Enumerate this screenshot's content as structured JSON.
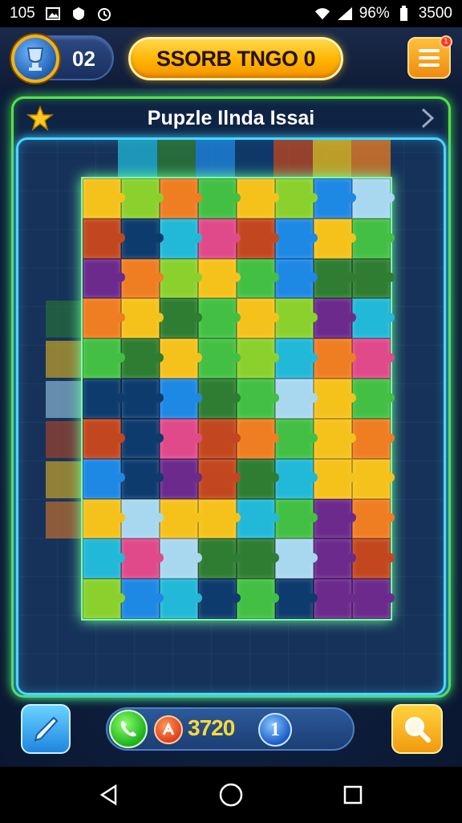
{
  "status": {
    "time": "105",
    "battery": "96%",
    "clock": "3500"
  },
  "header": {
    "level": "02",
    "title": "SSORB TNGO 0",
    "notification_count": "1"
  },
  "panel": {
    "title": "Pupzle Ilnda Issai"
  },
  "footer": {
    "score": "3720",
    "info_label": "1"
  },
  "colors": {
    "accent_green": "#58e04a",
    "accent_cyan": "#48d8ff",
    "brand_orange": "#ffb400",
    "piece_palette": [
      "#1e88e5",
      "#ef7d22",
      "#43c043",
      "#22b8d8",
      "#0e3b6e",
      "#f5c21b",
      "#8bd12e",
      "#c2471f",
      "#6b2a8c",
      "#e04a8a",
      "#a8d8f0",
      "#2e7d32"
    ]
  },
  "icons": {
    "level_badge": "trophy-icon",
    "menu": "menu-icon",
    "star": "star-icon",
    "chevron": "chevron-right-icon",
    "pencil": "pencil-icon",
    "phone": "phone-icon",
    "coin": "coin-icon",
    "search": "search-icon"
  }
}
